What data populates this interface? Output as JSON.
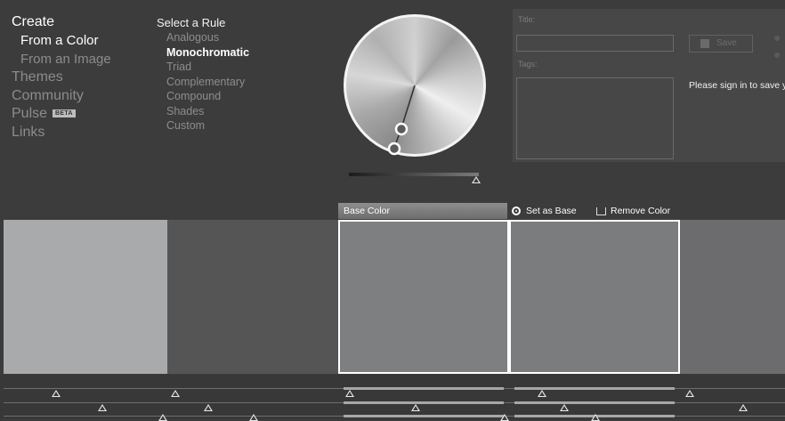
{
  "nav": {
    "create": "Create",
    "from_color": "From a Color",
    "from_image": "From an Image",
    "themes": "Themes",
    "community": "Community",
    "pulse": "Pulse",
    "beta": "BETA",
    "links": "Links"
  },
  "rules": {
    "title": "Select a Rule",
    "items": [
      "Analogous",
      "Monochromatic",
      "Triad",
      "Complementary",
      "Compound",
      "Shades",
      "Custom"
    ],
    "selected": "Monochromatic"
  },
  "panel": {
    "title_label": "Title:",
    "tags_label": "Tags:",
    "save_label": "Save",
    "signin_text": "Please sign in to save y"
  },
  "base": {
    "base_color_label": "Base Color",
    "set_as_base": "Set as Base",
    "remove_color": "Remove Color"
  },
  "swatches": [
    {
      "color": "#a9aaac",
      "selected": false
    },
    {
      "color": "#555556",
      "selected": false
    },
    {
      "color": "#7e7f81",
      "selected": true
    },
    {
      "color": "#7b7c7e",
      "selected": true
    },
    {
      "color": "#6c6c6e",
      "selected": false
    }
  ],
  "colors": {
    "background": "#3c3c3c",
    "panel": "#474747",
    "active_text": "#ffffff",
    "inactive_text": "#8c8c8c"
  }
}
